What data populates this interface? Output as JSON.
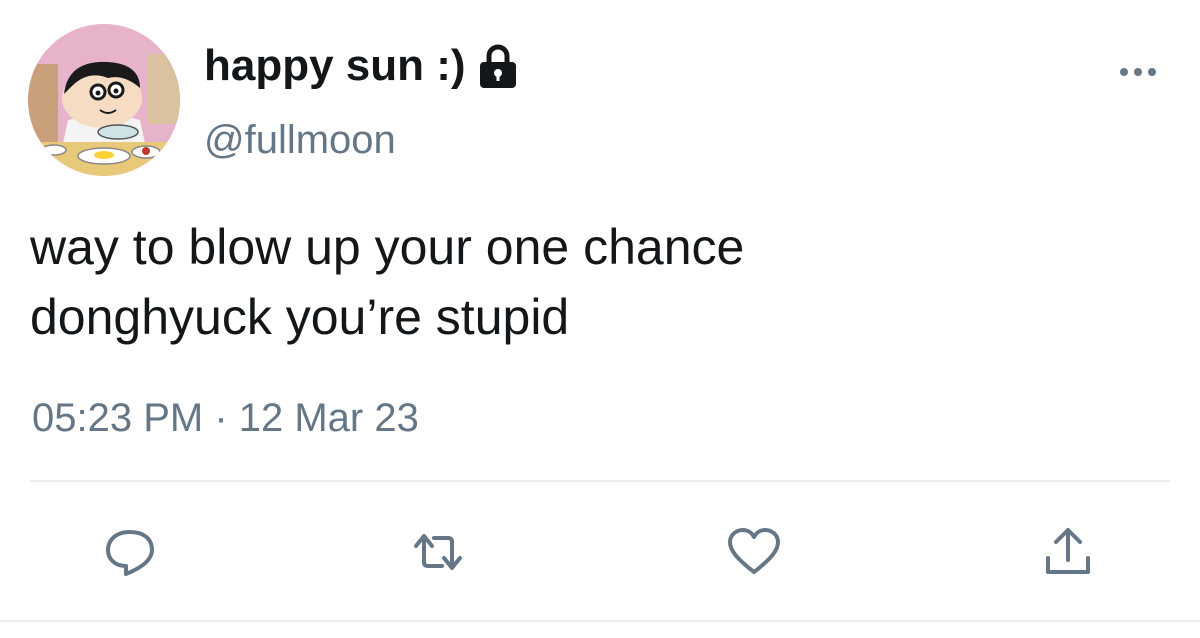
{
  "user": {
    "display_name": "happy sun :)",
    "handle": "@fullmoon",
    "protected": true,
    "avatar_icon": "cartoon-boy-eating-avatar"
  },
  "tweet": {
    "text": "way to blow up your one chance\ndonghyuck you’re stupid",
    "timestamp": "05:23 PM · 12 Mar 23"
  },
  "actions": [
    {
      "icon": "reply-icon"
    },
    {
      "icon": "retweet-icon"
    },
    {
      "icon": "like-icon"
    },
    {
      "icon": "share-icon"
    }
  ],
  "colors": {
    "text": "#14171a",
    "secondary": "#657786",
    "divider": "#e6ecf0"
  }
}
